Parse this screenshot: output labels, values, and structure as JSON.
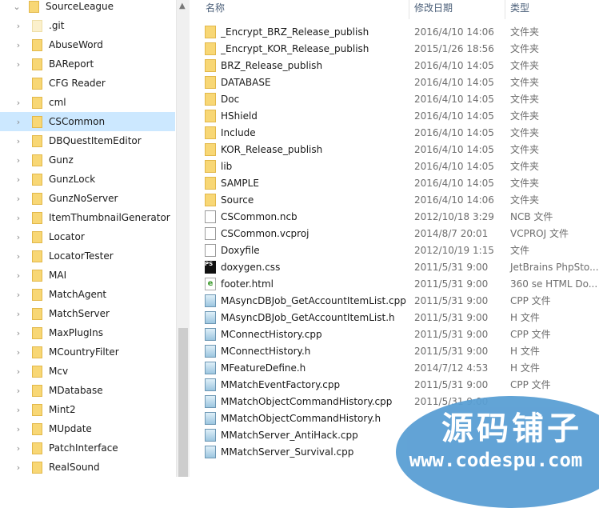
{
  "tree": {
    "items": [
      {
        "label": "SourceLeague",
        "expanded": true,
        "level": 0
      },
      {
        "label": ".git",
        "hidden": true
      },
      {
        "label": "AbuseWord"
      },
      {
        "label": "BAReport"
      },
      {
        "label": "CFG Reader",
        "no_children": true
      },
      {
        "label": "cml"
      },
      {
        "label": "CSCommon",
        "selected": true
      },
      {
        "label": "DBQuestItemEditor"
      },
      {
        "label": "Gunz"
      },
      {
        "label": "GunzLock"
      },
      {
        "label": "GunzNoServer"
      },
      {
        "label": "ItemThumbnailGenerator"
      },
      {
        "label": "Locator"
      },
      {
        "label": "LocatorTester"
      },
      {
        "label": "MAI"
      },
      {
        "label": "MatchAgent"
      },
      {
        "label": "MatchServer"
      },
      {
        "label": "MaxPlugIns"
      },
      {
        "label": "MCountryFilter"
      },
      {
        "label": "Mcv"
      },
      {
        "label": "MDatabase"
      },
      {
        "label": "Mint2"
      },
      {
        "label": "MUpdate"
      },
      {
        "label": "PatchInterface"
      },
      {
        "label": "RealSound"
      }
    ]
  },
  "columns": {
    "name": "名称",
    "date": "修改日期",
    "type": "类型"
  },
  "files": [
    {
      "name": "_Encrypt_BRZ_Release_publish",
      "date": "2016/4/10 14:06",
      "type": "文件夹",
      "icon": "folder"
    },
    {
      "name": "_Encrypt_KOR_Release_publish",
      "date": "2015/1/26 18:56",
      "type": "文件夹",
      "icon": "folder"
    },
    {
      "name": "BRZ_Release_publish",
      "date": "2016/4/10 14:05",
      "type": "文件夹",
      "icon": "folder"
    },
    {
      "name": "DATABASE",
      "date": "2016/4/10 14:05",
      "type": "文件夹",
      "icon": "folder"
    },
    {
      "name": "Doc",
      "date": "2016/4/10 14:05",
      "type": "文件夹",
      "icon": "folder"
    },
    {
      "name": "HShield",
      "date": "2016/4/10 14:05",
      "type": "文件夹",
      "icon": "folder"
    },
    {
      "name": "Include",
      "date": "2016/4/10 14:05",
      "type": "文件夹",
      "icon": "folder"
    },
    {
      "name": "KOR_Release_publish",
      "date": "2016/4/10 14:05",
      "type": "文件夹",
      "icon": "folder"
    },
    {
      "name": "lib",
      "date": "2016/4/10 14:05",
      "type": "文件夹",
      "icon": "folder"
    },
    {
      "name": "SAMPLE",
      "date": "2016/4/10 14:05",
      "type": "文件夹",
      "icon": "folder"
    },
    {
      "name": "Source",
      "date": "2016/4/10 14:06",
      "type": "文件夹",
      "icon": "folder"
    },
    {
      "name": "CSCommon.ncb",
      "date": "2012/10/18 3:29",
      "type": "NCB 文件",
      "icon": "file"
    },
    {
      "name": "CSCommon.vcproj",
      "date": "2014/8/7 20:01",
      "type": "VCPROJ 文件",
      "icon": "file"
    },
    {
      "name": "Doxyfile",
      "date": "2012/10/19 1:15",
      "type": "文件",
      "icon": "file"
    },
    {
      "name": "doxygen.css",
      "date": "2011/5/31 9:00",
      "type": "JetBrains PhpSto...",
      "icon": "ps"
    },
    {
      "name": "footer.html",
      "date": "2011/5/31 9:00",
      "type": "360 se HTML Do...",
      "icon": "html"
    },
    {
      "name": "MAsyncDBJob_GetAccountItemList.cpp",
      "date": "2011/5/31 9:00",
      "type": "CPP 文件",
      "icon": "code"
    },
    {
      "name": "MAsyncDBJob_GetAccountItemList.h",
      "date": "2011/5/31 9:00",
      "type": "H 文件",
      "icon": "code"
    },
    {
      "name": "MConnectHistory.cpp",
      "date": "2011/5/31 9:00",
      "type": "CPP 文件",
      "icon": "code"
    },
    {
      "name": "MConnectHistory.h",
      "date": "2011/5/31 9:00",
      "type": "H 文件",
      "icon": "code"
    },
    {
      "name": "MFeatureDefine.h",
      "date": "2014/7/12 4:53",
      "type": "H 文件",
      "icon": "code"
    },
    {
      "name": "MMatchEventFactory.cpp",
      "date": "2011/5/31 9:00",
      "type": "CPP 文件",
      "icon": "code"
    },
    {
      "name": "MMatchObjectCommandHistory.cpp",
      "date": "2011/5/31 9:00",
      "type": "",
      "icon": "code"
    },
    {
      "name": "MMatchObjectCommandHistory.h",
      "date": "",
      "type": "",
      "icon": "code"
    },
    {
      "name": "MMatchServer_AntiHack.cpp",
      "date": "",
      "type": "",
      "icon": "code"
    },
    {
      "name": "MMatchServer_Survival.cpp",
      "date": "",
      "type": "",
      "icon": "code"
    }
  ],
  "watermark": {
    "text": "源码铺子",
    "url": "www.codespu.com",
    "color": "#5a9fd4"
  },
  "colors": {
    "selection": "#cce8ff",
    "folder": "#f8d775"
  }
}
